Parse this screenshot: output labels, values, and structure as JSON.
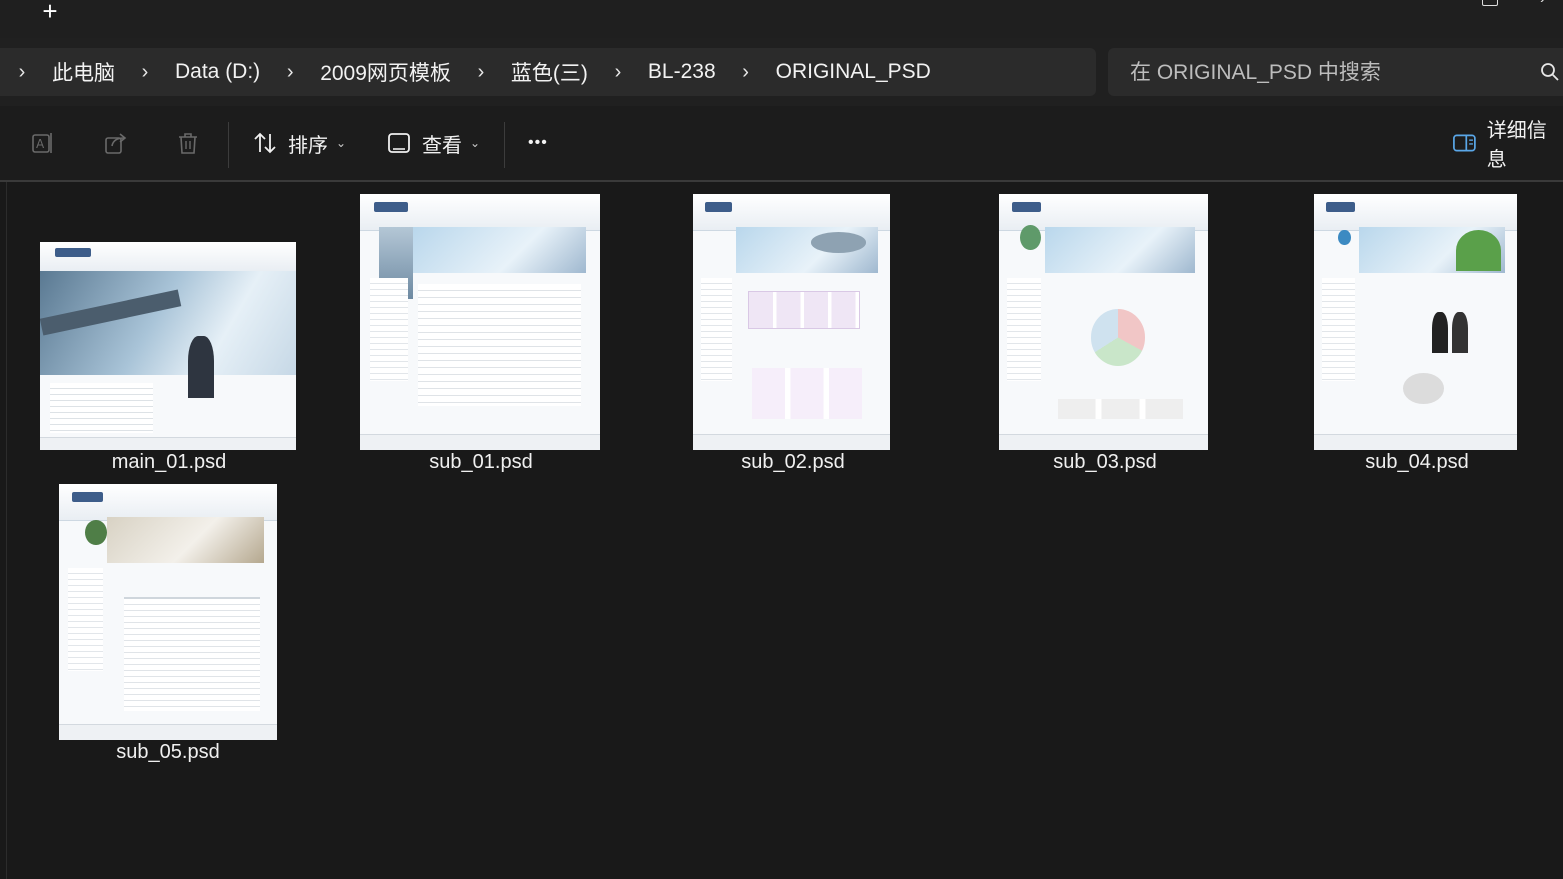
{
  "titlebar": {
    "new_tab_label": "+"
  },
  "breadcrumb": [
    "此电脑",
    "Data (D:)",
    "2009网页模板",
    "蓝色(三)",
    "BL-238",
    "ORIGINAL_PSD"
  ],
  "search": {
    "placeholder": "在 ORIGINAL_PSD 中搜索"
  },
  "toolbar": {
    "sort_label": "排序",
    "view_label": "查看",
    "more_label": "•••",
    "details_label": "详细信息"
  },
  "files": [
    {
      "name": "main_01.psd",
      "icon": "psd-thumbnail"
    },
    {
      "name": "sub_01.psd",
      "icon": "psd-thumbnail"
    },
    {
      "name": "sub_02.psd",
      "icon": "psd-thumbnail"
    },
    {
      "name": "sub_03.psd",
      "icon": "psd-thumbnail"
    },
    {
      "name": "sub_04.psd",
      "icon": "psd-thumbnail"
    },
    {
      "name": "sub_05.psd",
      "icon": "psd-thumbnail"
    }
  ],
  "colors": {
    "background": "#191919",
    "bar": "#2b2b2b",
    "text": "#f2f2f2"
  }
}
